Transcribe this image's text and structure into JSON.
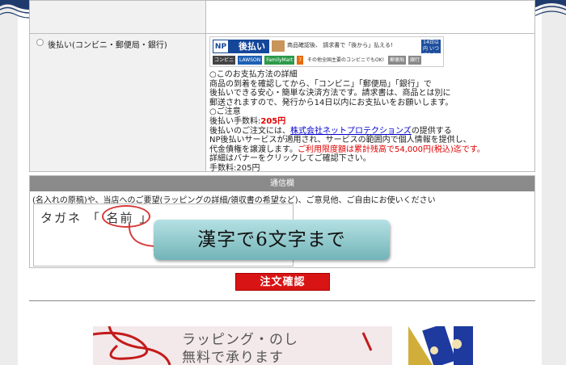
{
  "payment": {
    "option_label": "後払い(コンビニ・郵便局・銀行)",
    "banner": {
      "np_mark": "NP",
      "title": "後払い",
      "tagline": "商品確認後、",
      "tagline2": "請求書で「後から」払える!",
      "badge": "14日以内 いつでもOK",
      "stores": [
        "コンビニ",
        "LAWSON",
        "FamilyMart",
        "7",
        "その他全国主要のコンビニでもOK!",
        "郵便局",
        "銀行"
      ]
    },
    "details_heading": "○このお支払方法の詳細",
    "details_lines": [
      "商品の到着を確認してから、「コンビニ」「郵便局」「銀行」で",
      "後払いできる安心・簡単な決済方法です。請求書は、商品とは別に",
      "郵送されますので、発行から14日以内にお支払いをお願いします。"
    ],
    "notice_heading": "○ご注意",
    "fee_label": "後払い手数料:",
    "fee_value": "205円",
    "partner_prefix": "後払いのご注文には、",
    "partner_link": "株式会社ネットプロテクションズ",
    "partner_suffix": "の提供する",
    "notice_line2": "NP後払いサービスが適用され、サービスの範囲内で個人情報を提供し、",
    "limit_prefix": "代金債権を譲渡します。",
    "limit_red": "ご利用限度額は累計残高で54,000円(税込)迄です。",
    "banner_note": "詳細はバナーをクリックしてご確認下さい。",
    "fee_footer": "手数料:205円"
  },
  "message": {
    "header": "通信欄",
    "note": "(名入れの原稿)や、当店へのご要望(ラッピングの詳細/領収書の希望など)、ご意見他、ご自由にお使いください",
    "example_text": "タガネ 「 名前 」",
    "instruction_button": "漢字で6文字まで"
  },
  "confirm_button": "注文確認",
  "wrapping_banner": {
    "line1": "ラッピング・のし",
    "line2": "無料で承ります"
  },
  "colors": {
    "accent_red": "#d91414",
    "header_gray": "#8a8a8a",
    "np_blue": "#14479a",
    "button_teal": "#72b4b8"
  }
}
